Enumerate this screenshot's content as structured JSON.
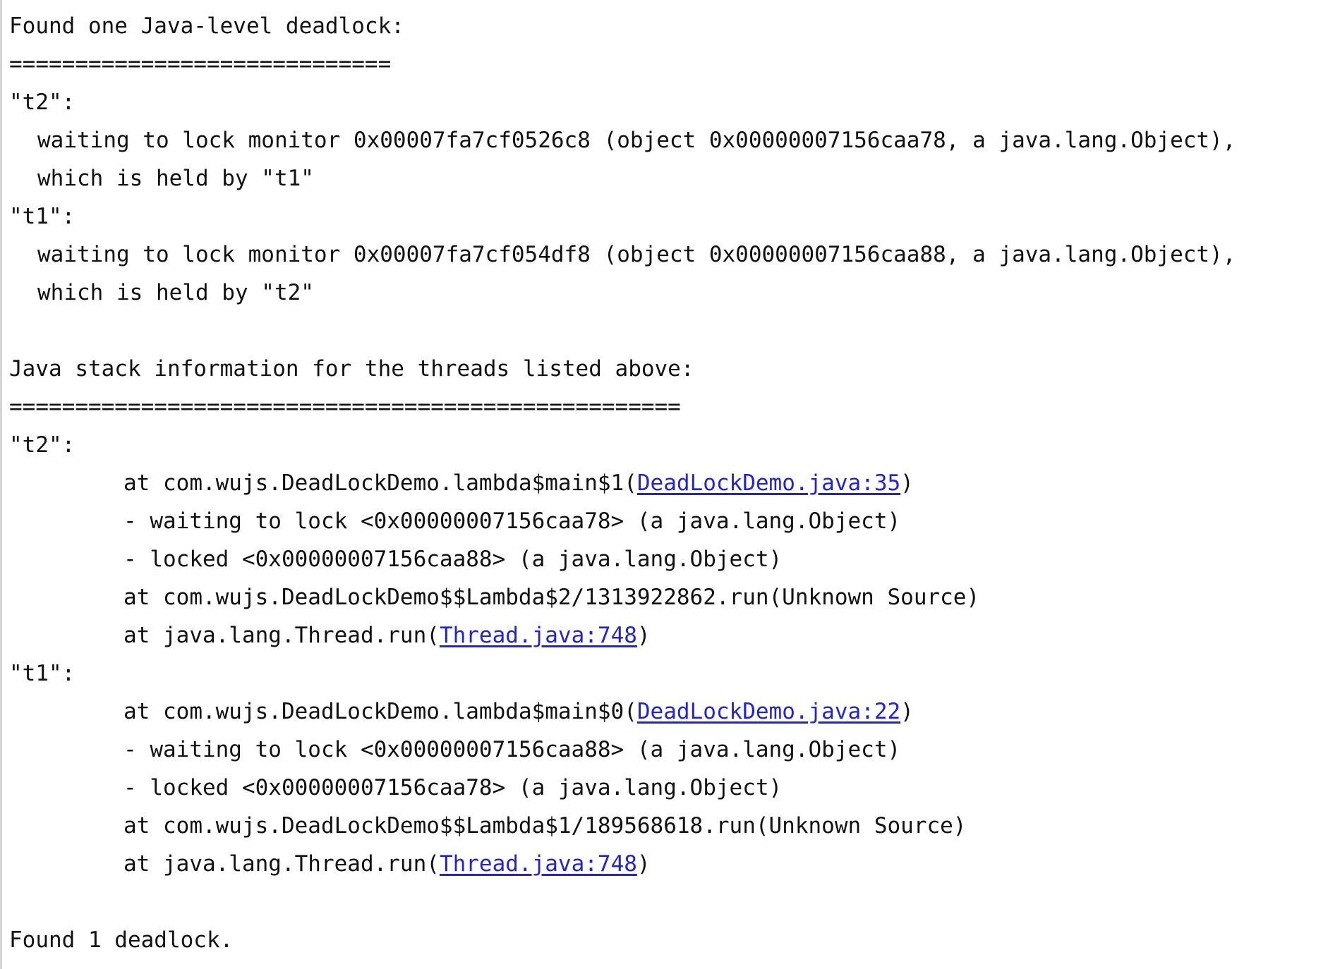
{
  "console": {
    "header": "Found one Java-level deadlock:",
    "separator1": "=============================",
    "deadlock_threads": [
      {
        "name": "\"t2\":",
        "waiting": "waiting to lock monitor 0x00007fa7cf0526c8 (object 0x00000007156caa78, a java.lang.Object),",
        "held_by": "which is held by \"t1\""
      },
      {
        "name": "\"t1\":",
        "waiting": "waiting to lock monitor 0x00007fa7cf054df8 (object 0x00000007156caa88, a java.lang.Object),",
        "held_by": "which is held by \"t2\""
      }
    ],
    "stack_header": "Java stack information for the threads listed above:",
    "separator2": "===================================================",
    "stacks": [
      {
        "name": "\"t2\":",
        "frame1_prefix": "at com.wujs.DeadLockDemo.lambda$main$1(",
        "frame1_link": "DeadLockDemo.java:35",
        "frame1_suffix": ")",
        "waiting": "- waiting to lock <0x00000007156caa78> (a java.lang.Object)",
        "locked": "- locked <0x00000007156caa88> (a java.lang.Object)",
        "frame2": "at com.wujs.DeadLockDemo$$Lambda$2/1313922862.run(Unknown Source)",
        "frame3_prefix": "at java.lang.Thread.run(",
        "frame3_link": "Thread.java:748",
        "frame3_suffix": ")"
      },
      {
        "name": "\"t1\":",
        "frame1_prefix": "at com.wujs.DeadLockDemo.lambda$main$0(",
        "frame1_link": "DeadLockDemo.java:22",
        "frame1_suffix": ")",
        "waiting": "- waiting to lock <0x00000007156caa88> (a java.lang.Object)",
        "locked": "- locked <0x00000007156caa78> (a java.lang.Object)",
        "frame2": "at com.wujs.DeadLockDemo$$Lambda$1/189568618.run(Unknown Source)",
        "frame3_prefix": "at java.lang.Thread.run(",
        "frame3_link": "Thread.java:748",
        "frame3_suffix": ")"
      }
    ],
    "footer": "Found 1 deadlock.",
    "colors": {
      "text": "#111111",
      "link": "#2323d6",
      "background": "#ffffff"
    }
  }
}
